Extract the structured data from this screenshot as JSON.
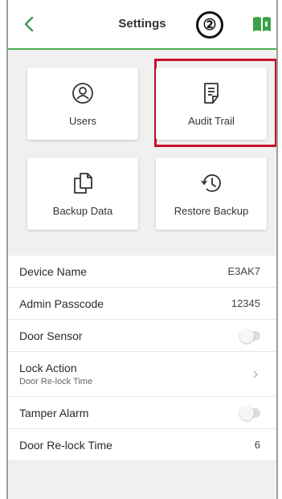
{
  "header": {
    "title": "Settings",
    "step_marker": "②",
    "accent_color": "#4caf50"
  },
  "icons": {
    "back": "chevron-left-icon",
    "book": "book-icon",
    "users": "user-icon",
    "audit": "document-icon",
    "backup": "copy-icon",
    "restore": "history-icon"
  },
  "tiles": {
    "users": "Users",
    "audit_trail": "Audit Trail",
    "backup_data": "Backup Data",
    "restore_backup": "Restore Backup",
    "highlight_color": "#c8102e"
  },
  "settings": {
    "device_name": {
      "label": "Device Name",
      "value": "E3AK7"
    },
    "admin_passcode": {
      "label": "Admin Passcode",
      "value": "12345"
    },
    "door_sensor": {
      "label": "Door Sensor",
      "enabled": false
    },
    "lock_action": {
      "label": "Lock Action",
      "sublabel": "Door Re-lock Time"
    },
    "tamper_alarm": {
      "label": "Tamper Alarm",
      "enabled": false
    },
    "door_relock_time": {
      "label": "Door Re-lock Time",
      "value": "6"
    }
  }
}
